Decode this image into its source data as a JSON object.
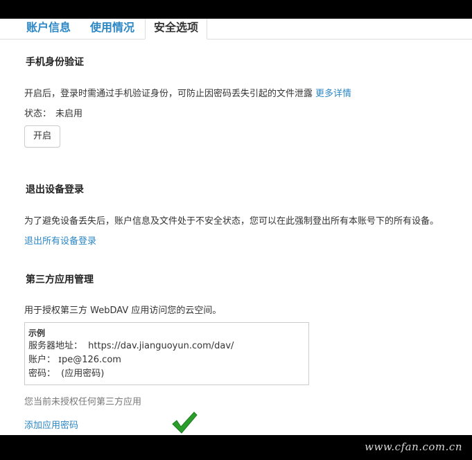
{
  "tabs": [
    {
      "label": "账户信息"
    },
    {
      "label": "使用情况"
    },
    {
      "label": "安全选项"
    }
  ],
  "phone_auth": {
    "title": "手机身份验证",
    "description": "开启后，登录时需通过手机验证身份，可防止因密码丢失引起的文件泄露",
    "more_link": "更多详情",
    "status_label": "状态：",
    "status_value": "未启用",
    "enable_button": "开启"
  },
  "logout_devices": {
    "title": "退出设备登录",
    "description": "为了避免设备丢失后，账户信息及文件处于不安全状态，您可以在此强制登出所有本账号下的所有设备。",
    "action_link": "退出所有设备登录"
  },
  "third_party": {
    "title": "第三方应用管理",
    "description": "用于授权第三方 WebDAV 应用访问您的云空间。",
    "example": {
      "title": "示例",
      "server_label": "服务器地址：",
      "server_value": "https://dav.jianguoyun.com/dav/",
      "account_label": "账户：",
      "account_value": "ɪpe@126.com",
      "password_label": "密码：",
      "password_value": "(应用密码)"
    },
    "no_apps_text": "您当前未授权任何第三方应用",
    "add_link": "添加应用密码"
  },
  "watermark": "www.cfan.com.cn",
  "colors": {
    "link": "#2b87c5",
    "check_green": "#2a9d2a"
  }
}
